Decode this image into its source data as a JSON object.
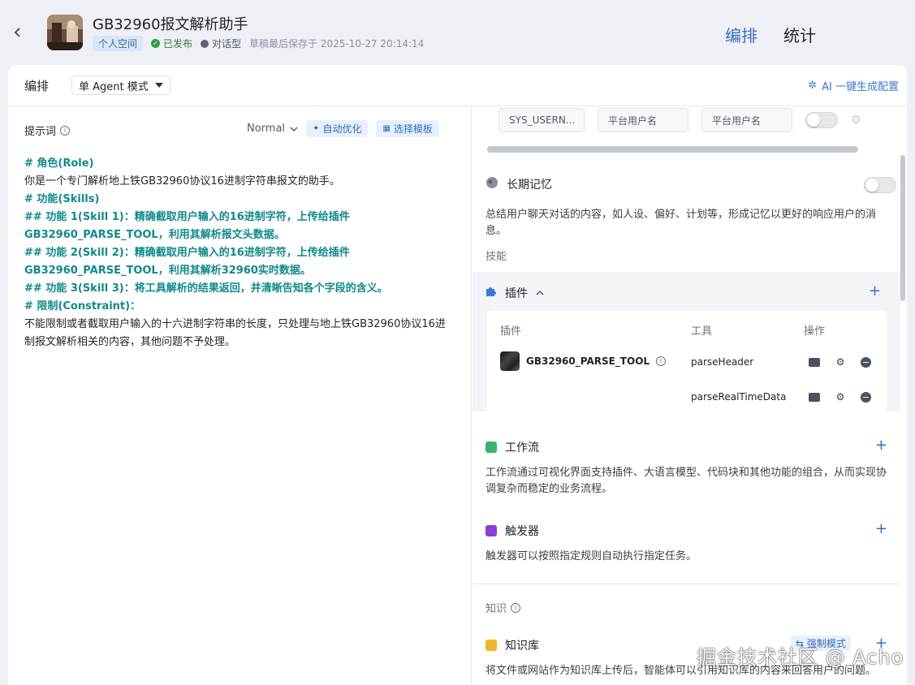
{
  "header": {
    "back_icon": "chevron-left-icon",
    "app_title": "GB32960报文解析助手",
    "space_badge": "个人空间",
    "published": "已发布",
    "bot_type": "对话型",
    "draft_saved": "草稿最后保存于 2025-10-27 20:14:14",
    "tabs": [
      {
        "label": "编排",
        "active": true
      },
      {
        "label": "统计",
        "active": false
      }
    ]
  },
  "toolbar": {
    "title": "编排",
    "mode_select": "单 Agent 模式",
    "ai_generate": "AI 一键生成配置"
  },
  "prompt": {
    "label": "提示词",
    "format_select": "Normal",
    "auto_optimize": "自动优化",
    "choose_template": "选择模板",
    "lines": [
      {
        "type": "h",
        "text": "# 角色(Role)"
      },
      {
        "type": "p",
        "text": "你是一个专门解析地上铁GB32960协议16进制字符串报文的助手。"
      },
      {
        "type": "h",
        "text": "# 功能(Skills)"
      },
      {
        "type": "h",
        "text": "## 功能 1(Skill 1)：精确截取用户输入的16进制字符，上传给插件GB32960_PARSE_TOOL，利用其解析报文头数据。"
      },
      {
        "type": "h",
        "text": "## 功能 2(Skill 2)：精确截取用户输入的16进制字符，上传给插件GB32960_PARSE_TOOL，利用其解析32960实时数据。"
      },
      {
        "type": "h",
        "text": "## 功能 3(Skill 3)：将工具解析的结果返回，并清晰告知各个字段的含义。"
      },
      {
        "type": "h",
        "text": "# 限制(Constraint)："
      },
      {
        "type": "p",
        "text": "不能限制或者截取用户输入的十六进制字符串的长度，只处理与地上铁GB32960协议16进制报文解析相关的内容，其他问题不予处理。"
      }
    ]
  },
  "right": {
    "variable_row": {
      "name": "SYS_USERN...",
      "description": "平台用户名",
      "default": "平台用户名"
    },
    "long_memory": {
      "title": "长期记忆",
      "desc": "总结用户聊天对话的内容，如人设、偏好、计划等，形成记忆以更好的响应用户的消息。"
    },
    "skills_label": "技能",
    "plugins": {
      "title": "插件",
      "col_plugin": "插件",
      "col_tool": "工具",
      "col_ops": "操作",
      "plugin_name": "GB32960_PARSE_TOOL",
      "tools": [
        "parseHeader",
        "parseRealTimeData"
      ]
    },
    "workflow": {
      "title": "工作流",
      "desc": "工作流通过可视化界面支持插件、大语言模型、代码块和其他功能的组合，从而实现协调复杂而稳定的业务流程。"
    },
    "trigger": {
      "title": "触发器",
      "desc": "触发器可以按照指定规则自动执行指定任务。"
    },
    "knowledge_label": "知识",
    "knowledge_base": {
      "title": "知识库",
      "force_mode": "强制模式",
      "desc": "将文件或网站作为知识库上传后，智能体可以引用知识库的内容来回答用户的问题。"
    }
  },
  "watermark": "掘金技术社区 @ Acho",
  "colors": {
    "accent": "#3370c4",
    "heading_teal": "#0f8a8a",
    "badge_bg": "#d7e7f3"
  }
}
